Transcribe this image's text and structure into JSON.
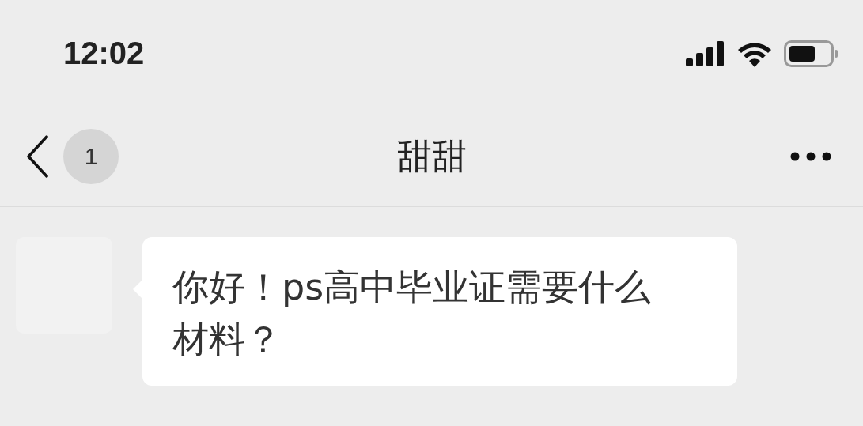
{
  "status_bar": {
    "time": "12:02"
  },
  "nav_bar": {
    "unread_count": "1",
    "title": "甜甜"
  },
  "messages": [
    {
      "kind": "incoming",
      "text": "你好！ps高中毕业证需要什么材料？"
    }
  ]
}
